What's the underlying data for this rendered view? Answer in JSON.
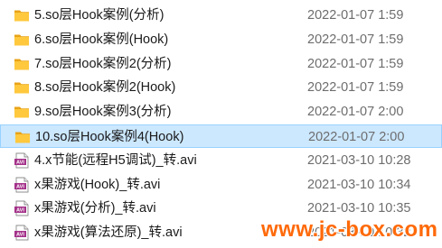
{
  "files": [
    {
      "name": "5.so层Hook案例(分析)",
      "date": "2022-01-07 1:59",
      "type": "folder",
      "selected": false
    },
    {
      "name": "6.so层Hook案例(Hook)",
      "date": "2022-01-07 1:59",
      "type": "folder",
      "selected": false
    },
    {
      "name": "7.so层Hook案例2(分析)",
      "date": "2022-01-07 1:59",
      "type": "folder",
      "selected": false
    },
    {
      "name": "8.so层Hook案例2(Hook)",
      "date": "2022-01-07 1:59",
      "type": "folder",
      "selected": false
    },
    {
      "name": "9.so层Hook案例3(分析)",
      "date": "2022-01-07 2:00",
      "type": "folder",
      "selected": false
    },
    {
      "name": "10.so层Hook案例4(Hook)",
      "date": "2022-01-07 2:00",
      "type": "folder",
      "selected": true
    },
    {
      "name": "4.x节能(远程H5调试)_转.avi",
      "date": "2021-03-10 10:28",
      "type": "avi",
      "selected": false
    },
    {
      "name": "x果游戏(Hook)_转.avi",
      "date": "2021-03-10 10:34",
      "type": "avi",
      "selected": false
    },
    {
      "name": "x果游戏(分析)_转.avi",
      "date": "2021-03-10 10:35",
      "type": "avi",
      "selected": false
    },
    {
      "name": "x果游戏(算法还原)_转.avi",
      "date": "2021-03-10 10:32",
      "type": "avi",
      "selected": false
    }
  ],
  "icon_labels": {
    "avi": "AVI"
  },
  "watermark": "www.jc-box.com",
  "colors": {
    "folder": "#ffc83d",
    "folder_back": "#e8a317",
    "avi_badge": "#a4328a",
    "selection": "#cce8ff",
    "watermark": "#ff6a0a"
  }
}
